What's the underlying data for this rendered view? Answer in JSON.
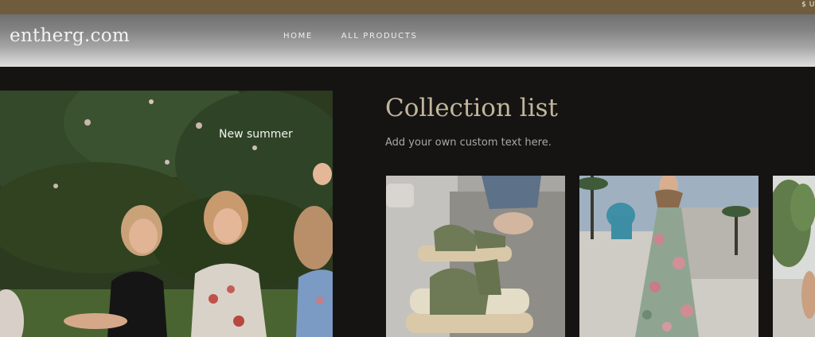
{
  "topbar": {
    "currency": "$ US"
  },
  "header": {
    "logo": "entherg.com",
    "nav": [
      {
        "label": "HOME"
      },
      {
        "label": "ALL PRODUCTS"
      }
    ]
  },
  "hero": {
    "caption": "New summer"
  },
  "collection": {
    "title": "Collection list",
    "subtitle": "Add your own custom text here."
  }
}
